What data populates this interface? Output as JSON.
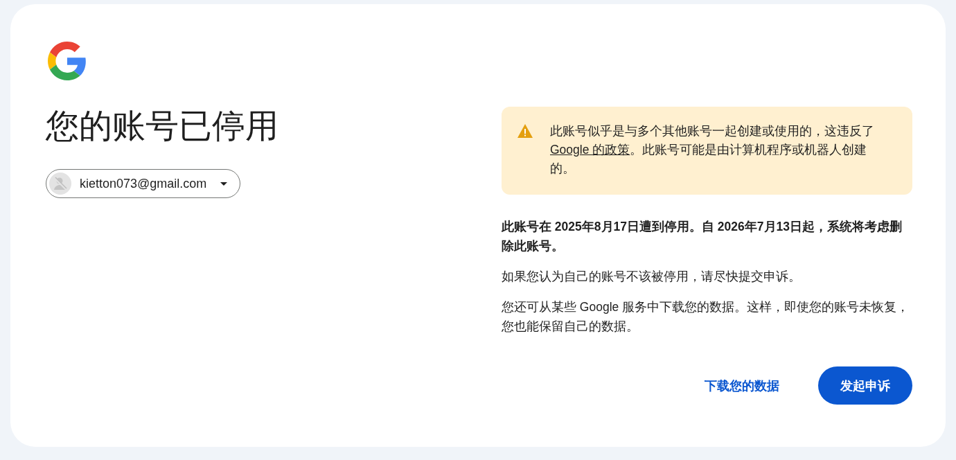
{
  "title": "您的账号已停用",
  "account": {
    "email": "kietton073@gmail.com"
  },
  "warning": {
    "before": "此账号似乎是与多个其他账号一起创建或使用的，这违反了 ",
    "link": "Google 的政策",
    "after": "。此账号可能是由计算机程序或机器人创建的。"
  },
  "paragraphs": [
    {
      "kind": "bold",
      "text": "此账号在 2025年8月17日遭到停用。自 2026年7月13日起，系统将考虑删除此账号。"
    },
    {
      "kind": "plain",
      "text": "如果您认为自己的账号不该被停用，请尽快提交申诉。"
    },
    {
      "kind": "plain",
      "text": "您还可从某些 Google 服务中下载您的数据。这样，即使您的账号未恢复，您也能保留自己的数据。"
    }
  ],
  "buttons": [
    {
      "kind": "text",
      "label": "下载您的数据"
    },
    {
      "kind": "filled",
      "label": "发起申诉"
    }
  ]
}
